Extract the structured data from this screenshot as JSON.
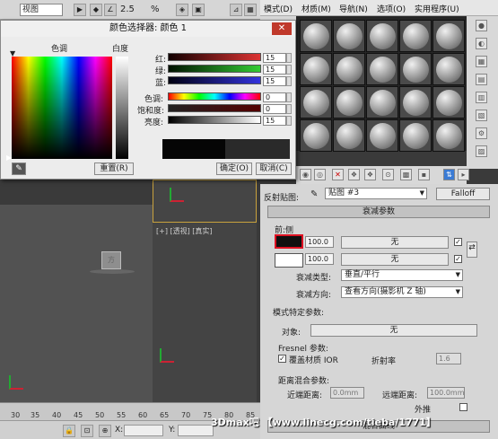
{
  "toolbar": {
    "view_select": "视图",
    "angle_label": "2.5",
    "pct_label": "%"
  },
  "material_editor": {
    "menus": [
      "模式(D)",
      "材质(M)",
      "导航(N)",
      "选项(O)",
      "实用程序(U)"
    ],
    "map_label": "反射贴图:",
    "map_name": "贴图 #3",
    "map_type": "Falloff",
    "falloff_rollout": "衰减参数",
    "front_side_label": "前:侧",
    "front_value": "100.0",
    "side_value": "100.0",
    "none_1": "无",
    "none_2": "无",
    "falloff_type_label": "衰减类型:",
    "falloff_type_value": "垂直/平行",
    "falloff_dir_label": "衰减方向:",
    "falloff_dir_value": "查看方向(摄影机 Z 轴)",
    "mode_params_label": "模式特定参数:",
    "object_label": "对象:",
    "object_value": "无",
    "fresnel_label": "Fresnel 参数:",
    "override_ior_label": "覆盖材质 IOR",
    "ior_label": "折射率",
    "ior_value": "1.6",
    "distance_blend_label": "距离混合参数:",
    "near_label": "近端距离:",
    "near_value": "0.0mm",
    "far_label": "远端距离:",
    "far_value": "100.0mm",
    "extrapolate_label": "外推",
    "mix_curve_rollout": "混合曲线"
  },
  "viewport": {
    "label": "[+] [透视] [真实]",
    "cube_text": "方"
  },
  "timeline": {
    "ticks": [
      "30",
      "35",
      "40",
      "45",
      "50",
      "55",
      "60",
      "65",
      "70",
      "75",
      "80",
      "85"
    ],
    "x_label": "X:",
    "y_label": "Y:"
  },
  "color_dialog": {
    "title": "颜色选择器: 颜色 1",
    "hue_label": "色调",
    "white_label": "白度",
    "red_label": "红:",
    "green_label": "绿:",
    "blue_label": "蓝:",
    "hue_row_label": "色调:",
    "sat_label": "饱和度:",
    "val_label": "亮度:",
    "red_value": "15",
    "green_value": "15",
    "blue_value": "15",
    "hue_value": "0",
    "sat_value": "0",
    "val_value": "15",
    "reset_button": "重置(R)",
    "ok_button": "确定(O)",
    "cancel_button": "取消(C)"
  },
  "watermark": "3Dmax吧 【www.linecg.com/tieba/1771】"
}
